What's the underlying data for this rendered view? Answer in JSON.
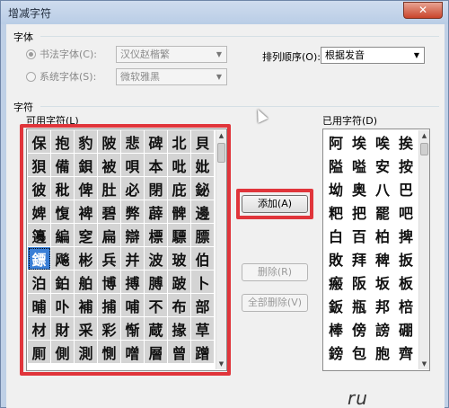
{
  "window": {
    "title": "增减字符",
    "close_label": "✕"
  },
  "font_group": {
    "label": "字体",
    "calligraphy_radio_label": "书法字体(C):",
    "calligraphy_value": "汉仪赵楷繁",
    "system_radio_label": "系统字体(S):",
    "system_value": "微软雅黑",
    "sort_label": "排列顺序(O):",
    "sort_value": "根据发音"
  },
  "chars_group": {
    "label": "字符",
    "available_label": "可用字符(L)",
    "used_label": "已用字符(D)",
    "available_chars": [
      [
        "保",
        "抱",
        "豹",
        "陂",
        "悲",
        "碑",
        "北",
        "貝"
      ],
      [
        "狽",
        "備",
        "鋇",
        "被",
        "唄",
        "本",
        "吡",
        "妣"
      ],
      [
        "彼",
        "秕",
        "俾",
        "肚",
        "必",
        "閉",
        "庇",
        "鉍"
      ],
      [
        "婢",
        "愎",
        "裨",
        "碧",
        "弊",
        "薜",
        "髀",
        "邊"
      ],
      [
        "籩",
        "編",
        "窆",
        "扁",
        "辯",
        "標",
        "驃",
        "膘"
      ],
      [
        "鏢",
        "飚",
        "彬",
        "兵",
        "并",
        "波",
        "玻",
        "伯"
      ],
      [
        "泊",
        "鉑",
        "舶",
        "博",
        "搏",
        "膊",
        "跛",
        "卜"
      ],
      [
        "晡",
        "卟",
        "補",
        "捕",
        "哺",
        "不",
        "布",
        "部"
      ],
      [
        "材",
        "財",
        "采",
        "彩",
        "惭",
        "蔵",
        "掾",
        "草"
      ],
      [
        "厠",
        "側",
        "測",
        "惻",
        "噌",
        "層",
        "曾",
        "蹭"
      ]
    ],
    "selected_char": "鏢",
    "used_chars": [
      [
        "阿",
        "埃",
        "唉",
        "挨"
      ],
      [
        "隘",
        "嗌",
        "安",
        "按"
      ],
      [
        "坳",
        "奥",
        "八",
        "巴"
      ],
      [
        "粑",
        "把",
        "罷",
        "吧"
      ],
      [
        "白",
        "百",
        "柏",
        "捭"
      ],
      [
        "敗",
        "拜",
        "稗",
        "扳"
      ],
      [
        "瘢",
        "阪",
        "坂",
        "板"
      ],
      [
        "鈑",
        "瓶",
        "邦",
        "棓"
      ],
      [
        "棒",
        "傍",
        "謗",
        "硼"
      ],
      [
        "鎊",
        "包",
        "胞",
        "齊"
      ]
    ],
    "add_button": "添加(A)",
    "delete_button": "删除(R)",
    "delete_all_button": "全部删除(V)"
  },
  "watermark": "ru"
}
